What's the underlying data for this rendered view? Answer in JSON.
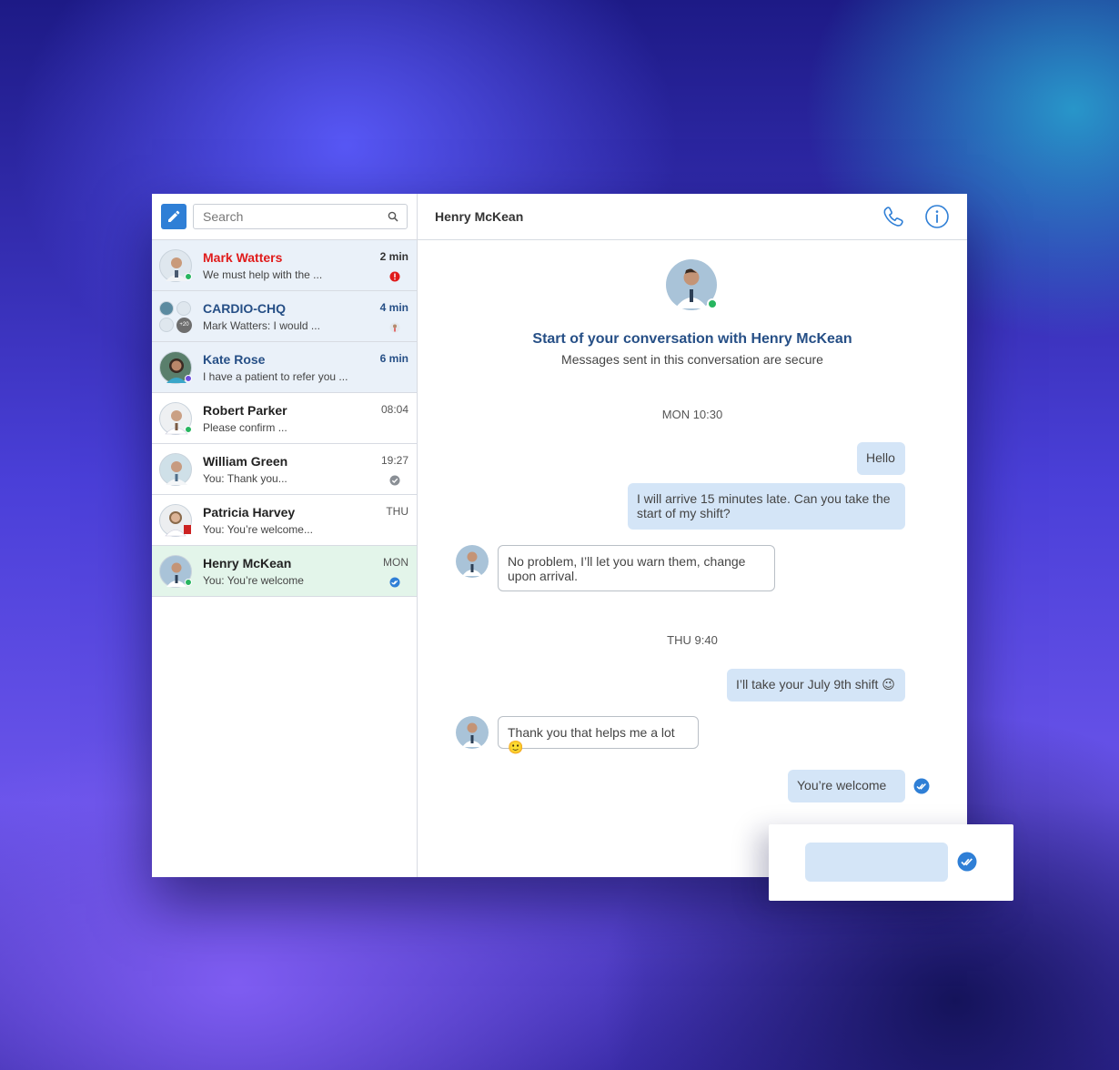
{
  "sidebar": {
    "search_placeholder": "Search",
    "conversations": [
      {
        "name": "Mark Watters",
        "preview": "We must help with the ...",
        "time": "2 min",
        "status": "alert"
      },
      {
        "name": "CARDIO-CHQ",
        "preview": "Mark Watters: I would ...",
        "time": "4 min",
        "group_count": "+20"
      },
      {
        "name": "Kate Rose",
        "preview": "I have a patient to refer you ...",
        "time": "6 min"
      },
      {
        "name": "Robert Parker",
        "preview": "Please confirm ...",
        "time": "08:04"
      },
      {
        "name": "William Green",
        "preview": "You: Thank you...",
        "time": "19:27",
        "status": "delivered"
      },
      {
        "name": "Patricia Harvey",
        "preview": "You: You’re welcome...",
        "time": "THU"
      },
      {
        "name": "Henry McKean",
        "preview": "You: You’re welcome",
        "time": "MON",
        "status": "read"
      }
    ]
  },
  "main": {
    "title": "Henry McKean",
    "intro_title": "Start of your conversation with Henry McKean",
    "intro_subtitle": "Messages sent in this conversation are secure",
    "date_1": "MON 10:30",
    "date_2": "THU 9:40",
    "messages": [
      {
        "dir": "out",
        "text": "Hello"
      },
      {
        "dir": "out",
        "text": "I will arrive 15 minutes late. Can you take the start of my shift?"
      },
      {
        "dir": "in",
        "text": "No problem, I’ll let you warn them, change upon arrival."
      },
      {
        "dir": "out",
        "text": "I’ll take your July 9th shift 😉"
      },
      {
        "dir": "in",
        "text": "Thank you that helps me a lot 🙂"
      },
      {
        "dir": "out",
        "text": "You’re welcome"
      }
    ]
  },
  "colors": {
    "accent": "#2f7fd6",
    "unread_bg": "#eaf1f9",
    "active_bg": "#e3f5ea",
    "out_bubble": "#d4e5f7",
    "alert": "#e01b1b",
    "online": "#27b55f"
  },
  "icons": {
    "compose": "pencil-icon",
    "search": "search-icon",
    "call": "phone-icon",
    "info": "info-icon",
    "read": "double-check-icon"
  }
}
